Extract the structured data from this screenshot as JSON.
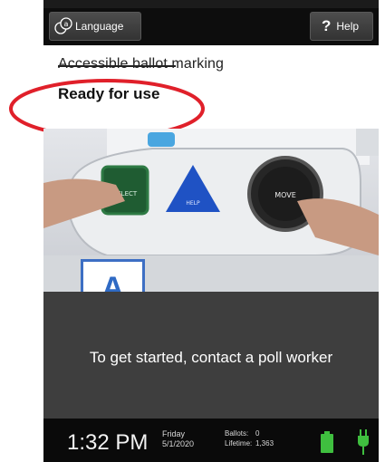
{
  "topbar": {
    "language_label": "Language",
    "help_label": "Help",
    "help_glyph": "?"
  },
  "status": {
    "subtitle": "Accessible ballot marking",
    "state": "Ready for use"
  },
  "photo": {
    "select_label": "SELECT",
    "help_label": "HELP",
    "move_label": "MOVE"
  },
  "callout": {
    "letter": "A"
  },
  "message": {
    "text": "To get started, contact a poll worker"
  },
  "footer": {
    "time": "1:32 PM",
    "weekday": "Friday",
    "date": "5/1/2020",
    "ballots_label": "Ballots:",
    "ballots_value": "0",
    "lifetime_label": "Lifetime:",
    "lifetime_value": "1,363"
  },
  "colors": {
    "highlight_ring": "#e0202a",
    "callout_border": "#3d6fc4",
    "battery": "#3fbf3f",
    "plug": "#3fbf3f"
  }
}
